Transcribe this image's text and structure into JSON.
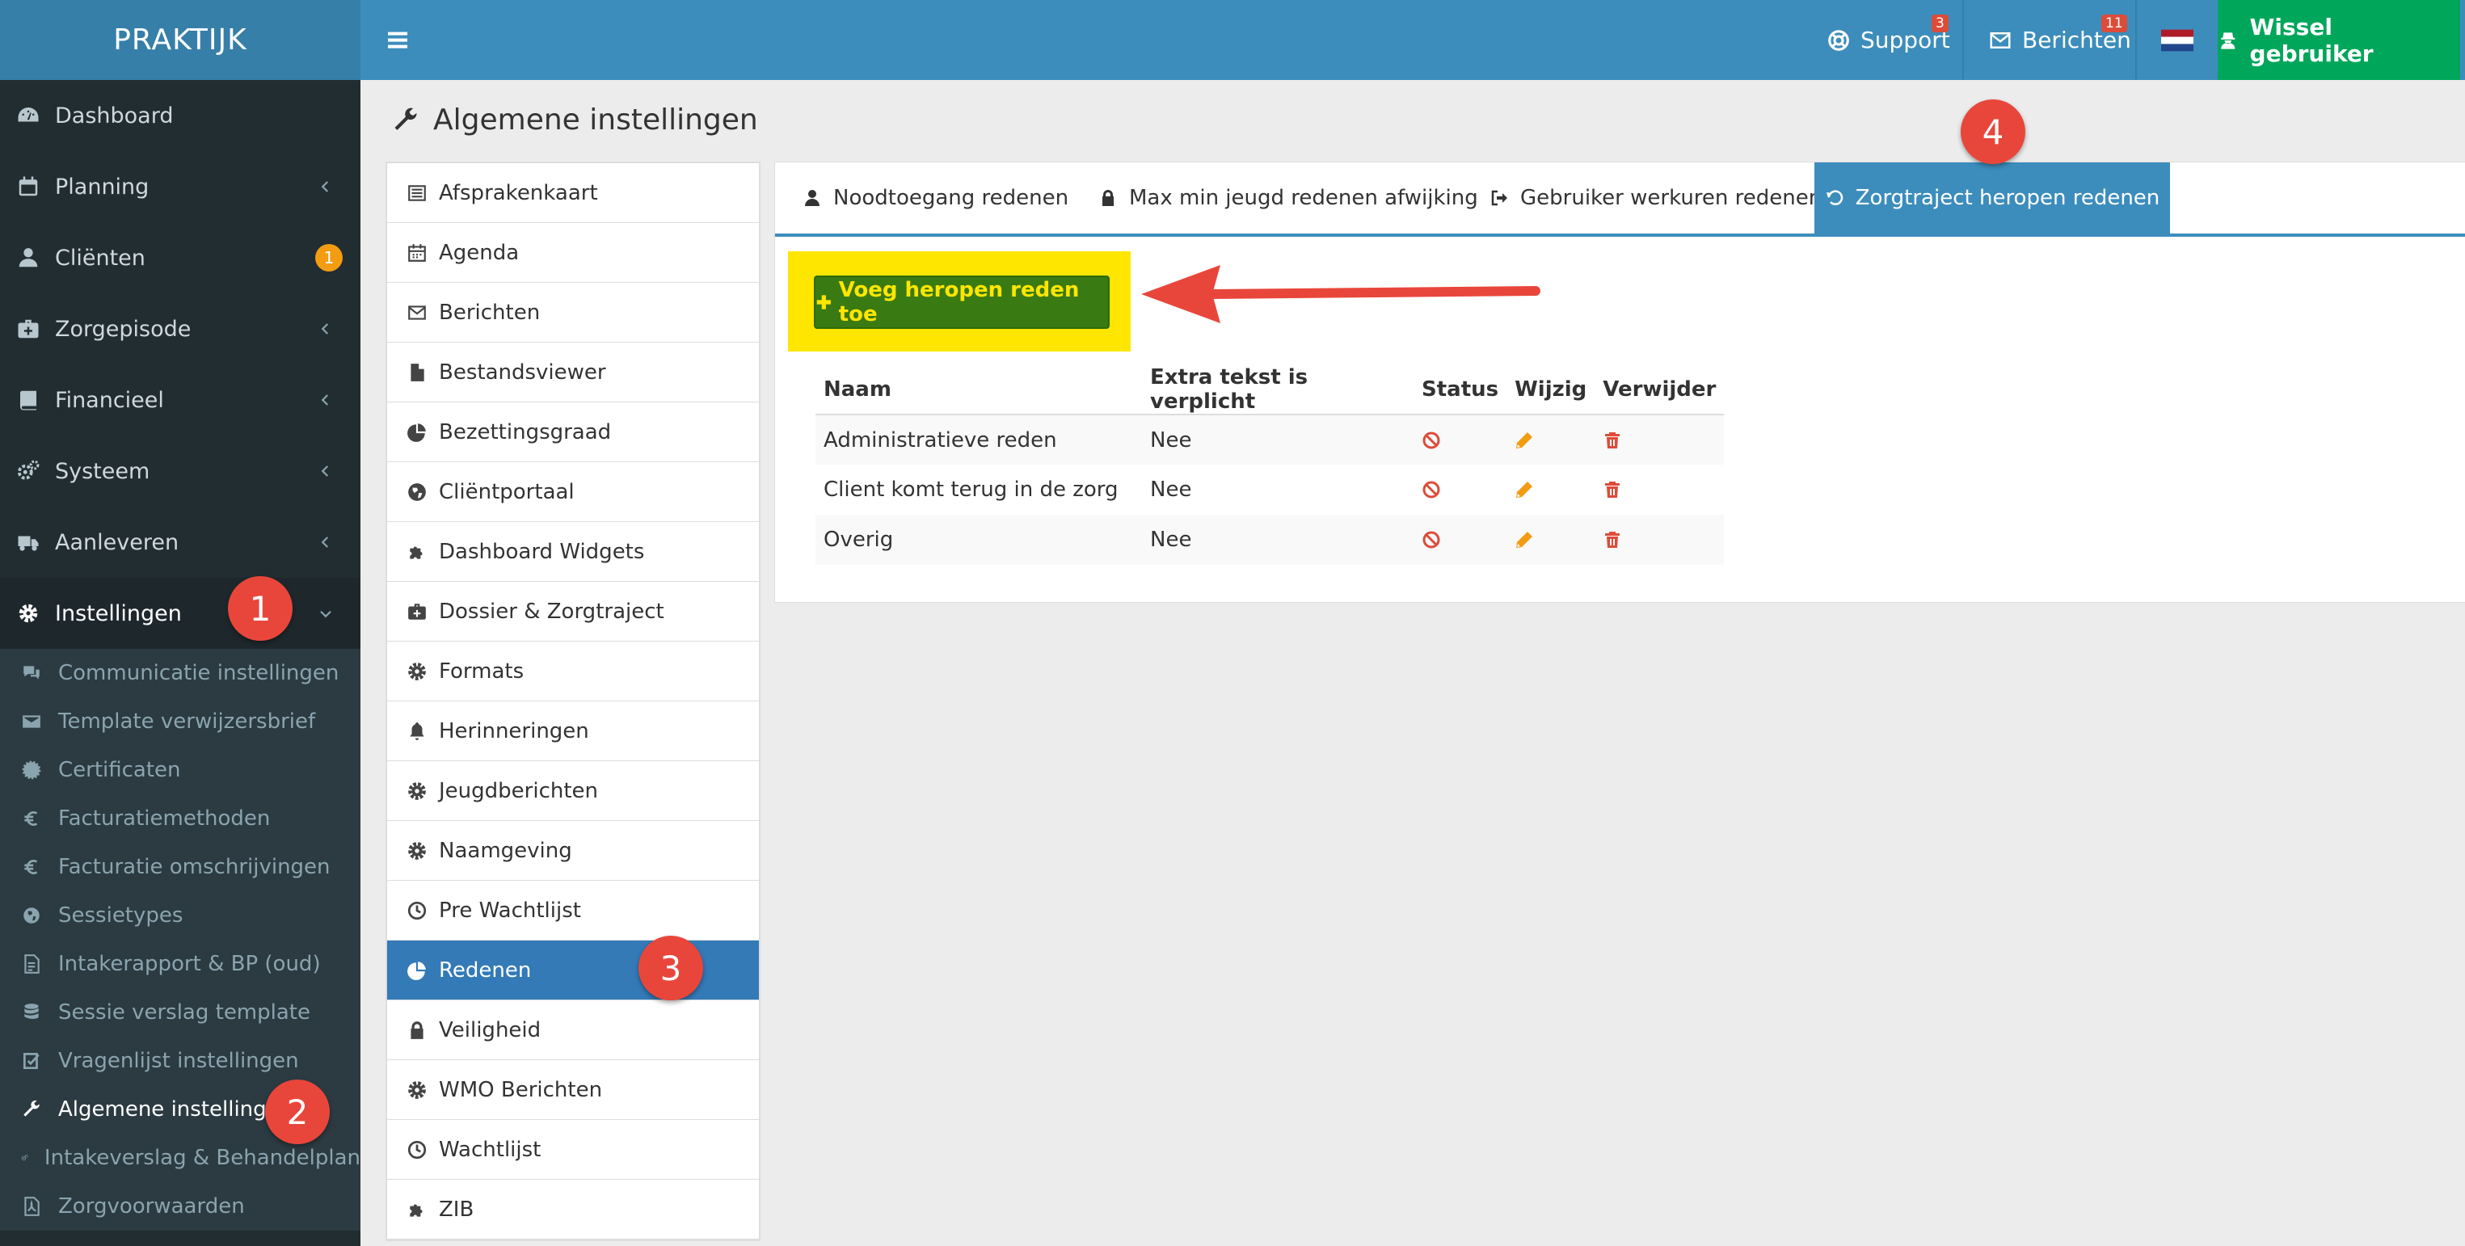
{
  "app": {
    "logo_text": "PRAKTIJK"
  },
  "topbar": {
    "support_label": "Support",
    "support_count": "3",
    "berichten_label": "Berichten",
    "berichten_count": "11",
    "wissel_label": "Wissel gebruiker",
    "flag_colors": [
      "#ae1c28",
      "#ffffff",
      "#21468b"
    ]
  },
  "sidebar": {
    "items": [
      {
        "label": "Dashboard",
        "icon": "dashboard-icon"
      },
      {
        "label": "Planning",
        "icon": "calendar-icon"
      },
      {
        "label": "Cliënten",
        "icon": "user-icon",
        "badge": "1"
      },
      {
        "label": "Zorgepisode",
        "icon": "medkit-icon"
      },
      {
        "label": "Financieel",
        "icon": "book-icon"
      },
      {
        "label": "Systeem",
        "icon": "cogs-icon"
      },
      {
        "label": "Aanleveren",
        "icon": "truck-icon"
      },
      {
        "label": "Instellingen",
        "icon": "gear-icon"
      }
    ],
    "subitems": [
      {
        "label": "Communicatie instellingen",
        "icon": "comments-icon"
      },
      {
        "label": "Template verwijzersbrief",
        "icon": "envelope-icon"
      },
      {
        "label": "Certificaten",
        "icon": "certificate-icon"
      },
      {
        "label": "Facturatiemethoden",
        "icon": "euro-icon"
      },
      {
        "label": "Facturatie omschrijvingen",
        "icon": "euro-icon"
      },
      {
        "label": "Sessietypes",
        "icon": "globe-icon"
      },
      {
        "label": "Intakerapport & BP (oud)",
        "icon": "file-icon"
      },
      {
        "label": "Sessie verslag template",
        "icon": "database-icon"
      },
      {
        "label": "Vragenlijst instellingen",
        "icon": "checkbox-icon"
      },
      {
        "label": "Algemene instellingen",
        "icon": "wrench-icon"
      },
      {
        "label": "Intakeverslag & Behandelplan",
        "icon": "cogs-icon"
      },
      {
        "label": "Zorgvoorwaarden",
        "icon": "pdf-icon"
      }
    ]
  },
  "page": {
    "title": "Algemene instellingen"
  },
  "settings_list": [
    {
      "label": "Afsprakenkaart",
      "icon": "list-alt-icon"
    },
    {
      "label": "Agenda",
      "icon": "calendar-icon"
    },
    {
      "label": "Berichten",
      "icon": "envelope-icon"
    },
    {
      "label": "Bestandsviewer",
      "icon": "file-icon"
    },
    {
      "label": "Bezettingsgraad",
      "icon": "pie-chart-icon"
    },
    {
      "label": "Cliëntportaal",
      "icon": "globe-icon"
    },
    {
      "label": "Dashboard Widgets",
      "icon": "puzzle-icon"
    },
    {
      "label": "Dossier & Zorgtraject",
      "icon": "medkit-icon"
    },
    {
      "label": "Formats",
      "icon": "gear-icon"
    },
    {
      "label": "Herinneringen",
      "icon": "bell-icon"
    },
    {
      "label": "Jeugdberichten",
      "icon": "gear-icon"
    },
    {
      "label": "Naamgeving",
      "icon": "gear-icon"
    },
    {
      "label": "Pre Wachtlijst",
      "icon": "clock-icon"
    },
    {
      "label": "Redenen",
      "icon": "pie-chart-icon"
    },
    {
      "label": "Veiligheid",
      "icon": "lock-icon"
    },
    {
      "label": "WMO Berichten",
      "icon": "gear-icon"
    },
    {
      "label": "Wachtlijst",
      "icon": "clock-icon"
    },
    {
      "label": "ZIB",
      "icon": "puzzle-icon"
    }
  ],
  "tabs": [
    {
      "label": "Noodtoegang redenen",
      "icon": "user-icon"
    },
    {
      "label": "Max min jeugd redenen afwijking",
      "icon": "lock-icon"
    },
    {
      "label": "Gebruiker werkuren redenen",
      "icon": "sign-out-icon"
    },
    {
      "label": "Zorgtraject heropen redenen",
      "icon": "undo-icon"
    }
  ],
  "add_button": {
    "label": "Voeg heropen reden toe"
  },
  "table": {
    "headers": [
      "Naam",
      "Extra tekst is verplicht",
      "Status",
      "Wijzig",
      "Verwijder"
    ],
    "rows": [
      {
        "naam": "Administratieve reden",
        "extra": "Nee"
      },
      {
        "naam": "Client komt terug in de zorg",
        "extra": "Nee"
      },
      {
        "naam": "Overig",
        "extra": "Nee"
      }
    ]
  },
  "annotations": [
    "1",
    "2",
    "3",
    "4"
  ]
}
